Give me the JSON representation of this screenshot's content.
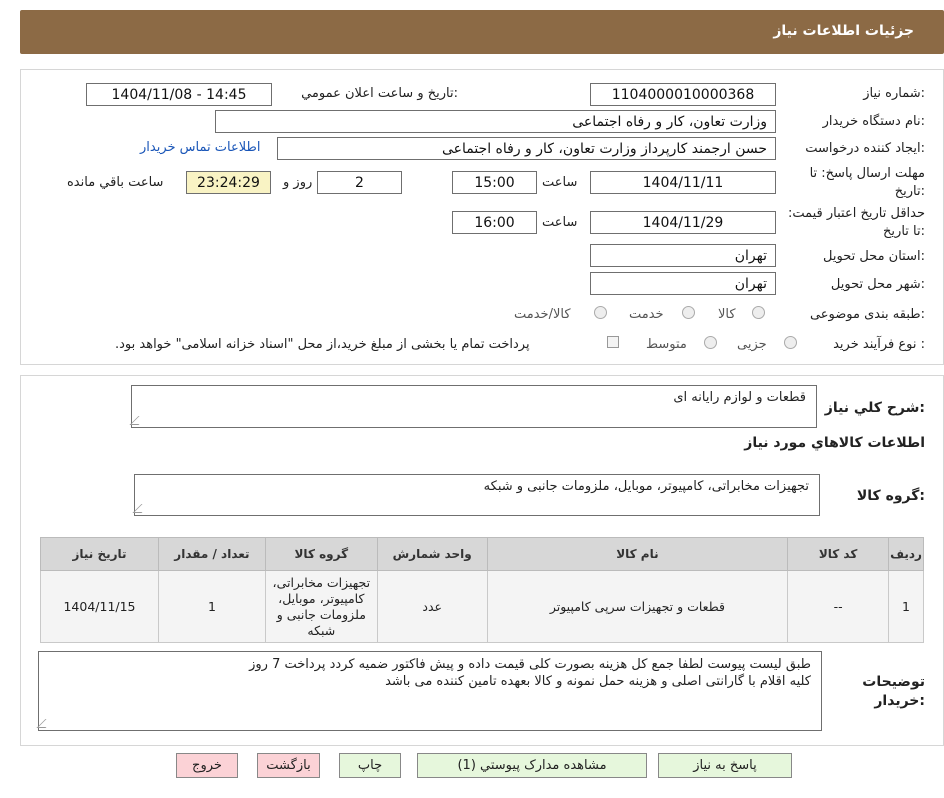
{
  "header": {
    "title": "جزئیات اطلاعات نیاز"
  },
  "watermark": {
    "text": "AriaTender.neT"
  },
  "form": {
    "need_number_label": "شماره نیاز:",
    "need_number": "1104000010000368",
    "announce_label": "تاریخ و ساعت اعلان عمومي:",
    "announce_value": "1404/11/08 - 14:45",
    "buyer_org_label": "نام دستگاه خريدار:",
    "buyer_org": "وزارت تعاون، کار و رفاه اجتماعی",
    "creator_label": "ایجاد کننده درخواست:",
    "creator": "حسن ارجمند کارپرداز وزارت تعاون، کار و رفاه اجتماعی",
    "contact_link": "اطلاعات تماس خریدار",
    "reply_deadline_label": "مهلت ارسال پاسخ: تا تاریخ:",
    "reply_date": "1404/11/11",
    "time_label": "ساعت",
    "reply_time": "15:00",
    "days": "2",
    "days_label": "روز و",
    "remaining": "23:24:29",
    "remaining_label": "ساعت باقي مانده",
    "validity_label": "حداقل تاریخ اعتبار قیمت: تا تاریخ:",
    "validity_date": "1404/11/29",
    "validity_time": "16:00",
    "province_label": "استان محل تحویل:",
    "province": "تهران",
    "city_label": "شهر محل تحویل:",
    "city": "تهران",
    "category_label": "طبقه بندی موضوعی:",
    "category_options": [
      "کالا",
      "خدمت",
      "کالا/خدمت"
    ],
    "process_label": "نوع فرآیند خرید :",
    "process_options": [
      "جزیی",
      "متوسط"
    ],
    "payment_note": "پرداخت تمام یا بخشی از مبلغ خرید،از محل \"اسناد خزانه اسلامی\" خواهد بود."
  },
  "details": {
    "summary_label": "شرح کلي نياز:",
    "summary": "قطعات و لوازم رایانه ای",
    "goods_info_title": "اطلاعات کالاهاي مورد نياز",
    "goods_group_label": "گروه کالا:",
    "goods_group": "تجهیزات مخابراتی، کامپیوتر، موبایل، ملزومات جانبی و شبکه",
    "table": {
      "headers": [
        "رديف",
        "کد کالا",
        "نام کالا",
        "واحد شمارش",
        "گروه کالا",
        "تعداد / مقدار",
        "تاریخ نیاز"
      ],
      "rows": [
        [
          "1",
          "--",
          "قطعات و تجهیزات سرپی کامپیوتر",
          "عدد",
          "تجهیزات مخابراتی، کامپیوتر، موبایل، ملزومات جانبی و شبکه",
          "1",
          "1404/11/15"
        ]
      ]
    },
    "buyer_notes_label": "توضیحات خریدار:",
    "buyer_notes_line1": "طبق لیست پیوست لطفا جمع کل هزینه بصورت کلی قیمت داده و پیش فاکتور ضمیه کردد پرداخت 7 روز",
    "buyer_notes_line2": "کلیه اقلام با گارانتی اصلی  و هزینه حمل نمونه و کالا بعهده تامین کننده می باشد"
  },
  "buttons": {
    "reply": "پاسخ به نیاز",
    "attachments": "مشاهده مدارک پیوستي (1)",
    "print": "چاپ",
    "back": "بازگشت",
    "exit": "خروج"
  }
}
